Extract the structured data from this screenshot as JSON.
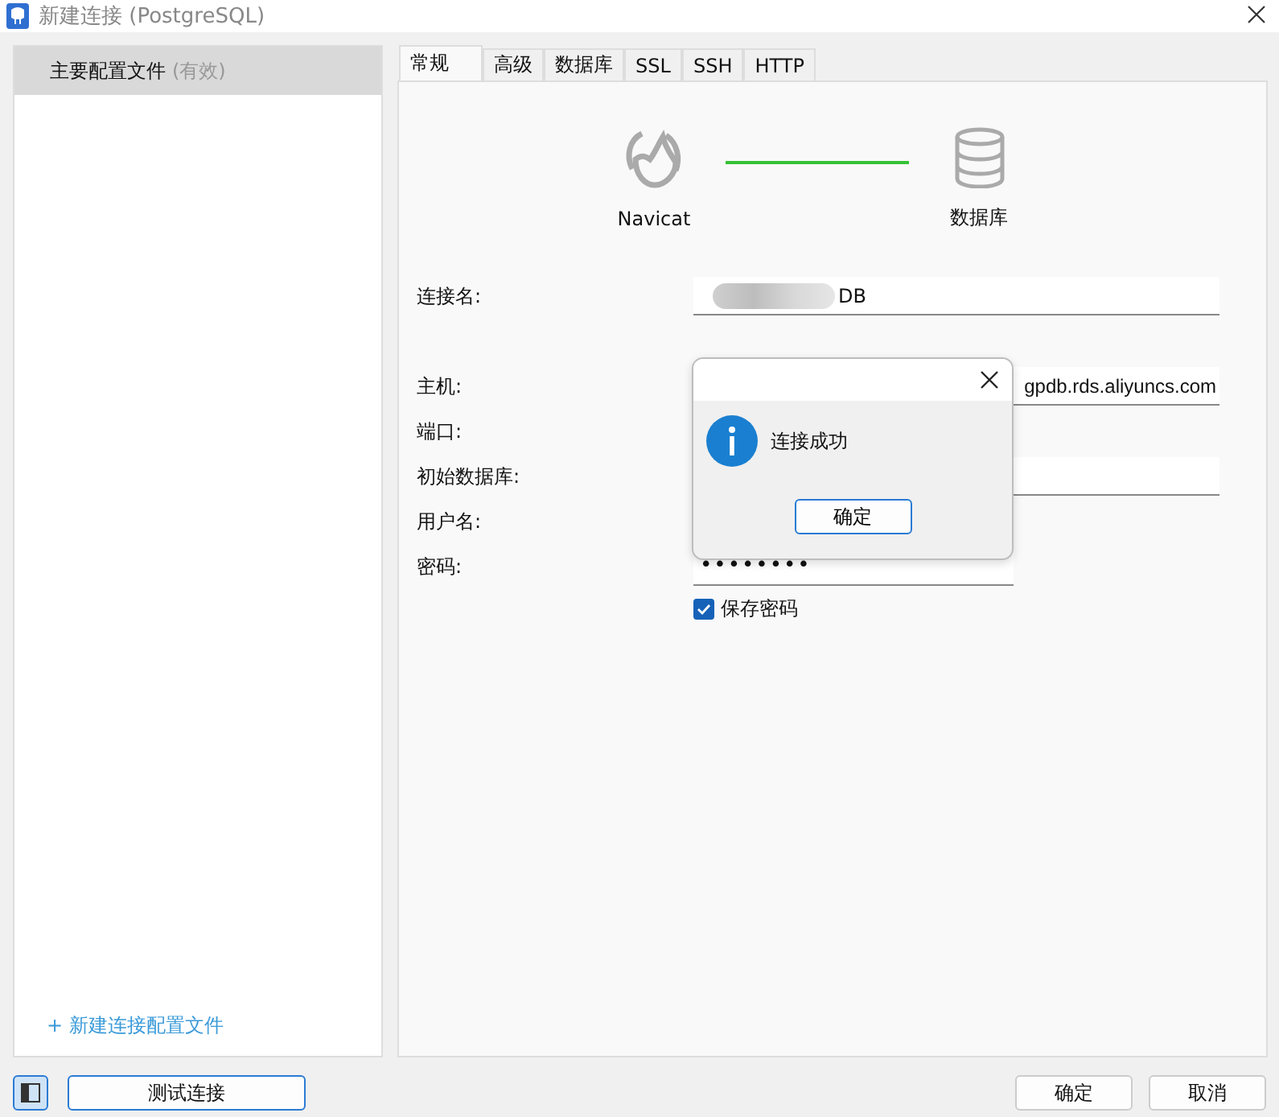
{
  "window": {
    "title": "新建连接 (PostgreSQL)"
  },
  "sidebar": {
    "items": [
      {
        "name": "主要配置文件",
        "status": "(有效)",
        "selected": true
      }
    ],
    "add_link": "+ 新建连接配置文件"
  },
  "tabs": [
    {
      "label": "常规",
      "selected": true
    },
    {
      "label": "高级",
      "selected": false
    },
    {
      "label": "数据库",
      "selected": false
    },
    {
      "label": "SSL",
      "selected": false
    },
    {
      "label": "SSH",
      "selected": false
    },
    {
      "label": "HTTP",
      "selected": false
    }
  ],
  "diagram": {
    "left_label": "Navicat",
    "right_label": "数据库",
    "connected": true
  },
  "form": [
    {
      "label": "连接名:",
      "kind": "text",
      "value": "DB",
      "redacted": true
    },
    {
      "label": "主机:",
      "kind": "host",
      "value": "gpdb.rds.aliyuncs.com"
    },
    {
      "label": "端口:",
      "kind": "hidden"
    },
    {
      "label": "初始数据库:",
      "kind": "wide"
    },
    {
      "label": "用户名:",
      "kind": "hidden"
    },
    {
      "label": "密码:",
      "kind": "password",
      "value": "••••••••"
    }
  ],
  "save_password": {
    "label": "保存密码",
    "checked": true
  },
  "dialog": {
    "message": "连接成功",
    "button": "确定"
  },
  "buttons": {
    "test": "测试连接",
    "ok": "确定",
    "cancel": "取消"
  }
}
